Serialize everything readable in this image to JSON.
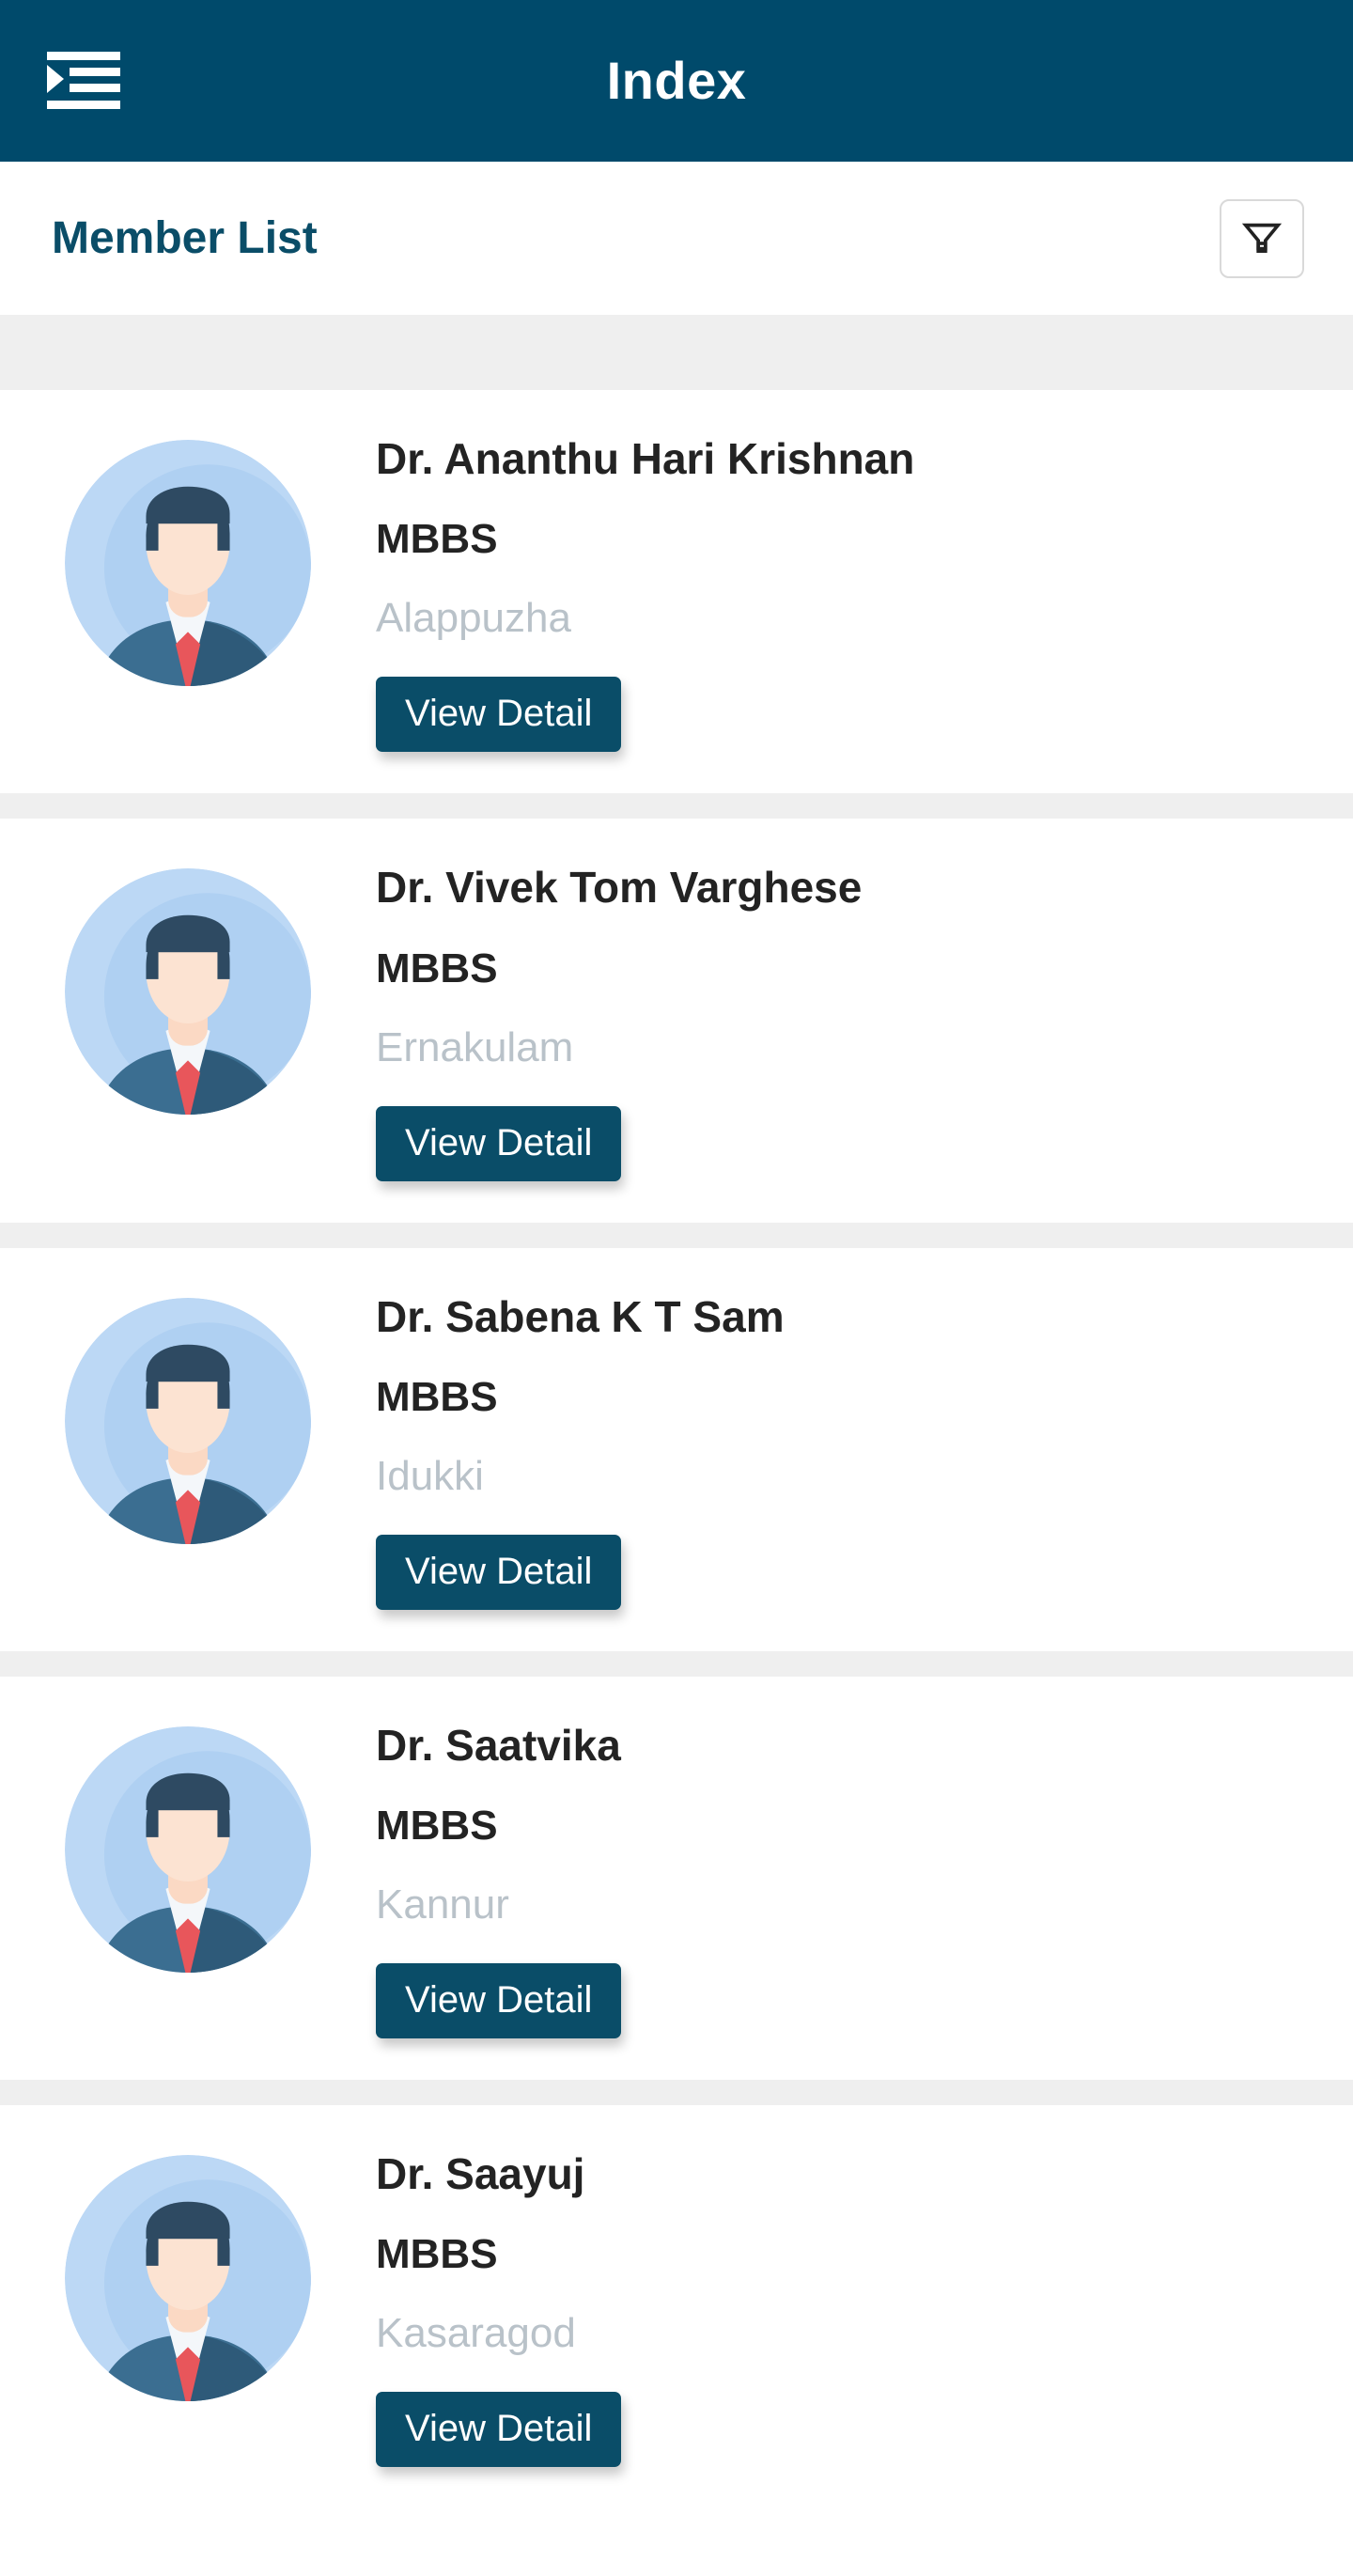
{
  "appbar": {
    "title": "Index",
    "menu_icon": "hamburger-indent-icon",
    "bg_color": "#004A6B",
    "text_color": "#FFFFFF"
  },
  "subheader": {
    "title": "Member List",
    "title_color": "#0A4D68",
    "filter_icon": "filter-funnel-icon"
  },
  "colors": {
    "accent": "#0A4D68",
    "header": "#004A6B",
    "band": "#EFEFEF",
    "name_text": "#232323",
    "place_text": "#B9C2C9",
    "avatar_bg": "#BCD8F5",
    "avatar_hair": "#2E4A62",
    "avatar_skin": "#FCDFCB",
    "avatar_suit": "#3B6E91",
    "avatar_suit_dark": "#2E5A79",
    "avatar_shirt": "#F4F7FA",
    "avatar_tie": "#E8565B"
  },
  "members": [
    {
      "name": "Dr. Ananthu Hari Krishnan",
      "qualification": "MBBS",
      "place": "Alappuzha",
      "action_label": "View Detail",
      "avatar_icon": "user-avatar-icon"
    },
    {
      "name": "Dr. Vivek Tom Varghese",
      "qualification": "MBBS",
      "place": "Ernakulam",
      "action_label": "View Detail",
      "avatar_icon": "user-avatar-icon"
    },
    {
      "name": "Dr. Sabena K T Sam",
      "qualification": "MBBS",
      "place": "Idukki",
      "action_label": "View Detail",
      "avatar_icon": "user-avatar-icon"
    },
    {
      "name": "Dr. Saatvika",
      "qualification": "MBBS",
      "place": "Kannur",
      "action_label": "View Detail",
      "avatar_icon": "user-avatar-icon"
    },
    {
      "name": "Dr. Saayuj",
      "qualification": "MBBS",
      "place": "Kasaragod",
      "action_label": "View Detail",
      "avatar_icon": "user-avatar-icon"
    }
  ]
}
